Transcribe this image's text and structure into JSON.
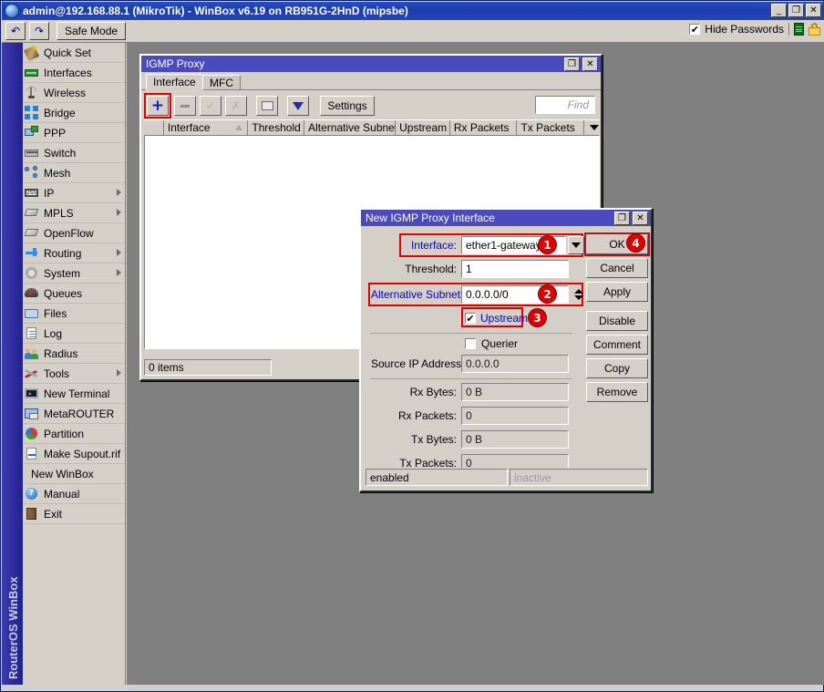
{
  "window": {
    "title": "admin@192.168.88.1 (MikroTik) - WinBox v6.19 on RB951G-2HnD (mipsbe)",
    "icon": "winbox-globe-icon",
    "minimize": "_",
    "restore": "❐",
    "close": "✕"
  },
  "toolbar": {
    "undo_label": "↶",
    "redo_label": "↷",
    "safe_mode_label": "Safe Mode",
    "hide_passwords_label": "Hide Passwords",
    "hide_passwords_checked": "✔",
    "memory_icon": "memory-icon",
    "lock_icon": "lock-icon"
  },
  "rail": {
    "label": "RouterOS WinBox"
  },
  "menu": {
    "items": [
      {
        "label": "Quick Set",
        "icon": "magic-wand-icon",
        "submenu": false
      },
      {
        "label": "Interfaces",
        "icon": "network-card-icon",
        "submenu": false
      },
      {
        "label": "Wireless",
        "icon": "antenna-icon",
        "submenu": false
      },
      {
        "label": "Bridge",
        "icon": "bridge-icon",
        "submenu": false
      },
      {
        "label": "PPP",
        "icon": "ppp-icon",
        "submenu": false
      },
      {
        "label": "Switch",
        "icon": "switch-icon",
        "submenu": false
      },
      {
        "label": "Mesh",
        "icon": "mesh-icon",
        "submenu": false
      },
      {
        "label": "IP",
        "icon": "ip-icon",
        "submenu": true
      },
      {
        "label": "MPLS",
        "icon": "tag-icon",
        "submenu": true
      },
      {
        "label": "OpenFlow",
        "icon": "tag-icon",
        "submenu": false
      },
      {
        "label": "Routing",
        "icon": "routing-icon",
        "submenu": true
      },
      {
        "label": "System",
        "icon": "gear-icon",
        "submenu": true
      },
      {
        "label": "Queues",
        "icon": "queues-icon",
        "submenu": false
      },
      {
        "label": "Files",
        "icon": "folder-icon",
        "submenu": false
      },
      {
        "label": "Log",
        "icon": "log-icon",
        "submenu": false
      },
      {
        "label": "Radius",
        "icon": "users-icon",
        "submenu": false
      },
      {
        "label": "Tools",
        "icon": "tools-icon",
        "submenu": true
      },
      {
        "label": "New Terminal",
        "icon": "terminal-icon",
        "submenu": false
      },
      {
        "label": "MetaROUTER",
        "icon": "metarouter-icon",
        "submenu": false
      },
      {
        "label": "Partition",
        "icon": "partition-pie-icon",
        "submenu": false
      },
      {
        "label": "Make Supout.rif",
        "icon": "supout-file-icon",
        "submenu": false
      },
      {
        "label": "New WinBox",
        "icon": "",
        "submenu": false
      },
      {
        "label": "Manual",
        "icon": "question-icon",
        "submenu": false
      },
      {
        "label": "Exit",
        "icon": "exit-door-icon",
        "submenu": false
      }
    ]
  },
  "igmp_window": {
    "title": "IGMP Proxy",
    "restore": "❐",
    "close": "✕",
    "tabs": [
      {
        "label": "Interface",
        "active": true
      },
      {
        "label": "MFC",
        "active": false
      }
    ],
    "toolbar": {
      "add_label": "+",
      "remove_label": "−",
      "enable_label": "✓",
      "disable_label": "✗",
      "comment_label": "comment-icon",
      "filter_label": "filter-icon",
      "settings_label": "Settings"
    },
    "find_placeholder": "Find",
    "columns": [
      "Interface",
      "Threshold",
      "Alternative Subnets",
      "Upstream",
      "Rx Packets",
      "Tx Packets"
    ],
    "rows": [],
    "status": "0 items"
  },
  "dialog": {
    "title": "New IGMP Proxy Interface",
    "restore": "❐",
    "close": "✕",
    "fields": {
      "interface_label": "Interface:",
      "interface_value": "ether1-gateway",
      "threshold_label": "Threshold:",
      "threshold_value": "1",
      "alt_subnets_label": "Alternative Subnets:",
      "alt_subnets_value": "0.0.0.0/0",
      "upstream_label": "Upstream",
      "upstream_checked": "✔",
      "querier_label": "Querier",
      "querier_checked": "",
      "source_ip_label": "Source IP Address:",
      "source_ip_value": "0.0.0.0",
      "rx_bytes_label": "Rx Bytes:",
      "rx_bytes_value": "0 B",
      "rx_packets_label": "Rx Packets:",
      "rx_packets_value": "0",
      "tx_bytes_label": "Tx Bytes:",
      "tx_bytes_value": "0 B",
      "tx_packets_label": "Tx Packets:",
      "tx_packets_value": "0"
    },
    "buttons": [
      "OK",
      "Cancel",
      "Apply",
      "Disable",
      "Comment",
      "Copy",
      "Remove"
    ],
    "status_left": "enabled",
    "status_right": "inactive"
  },
  "annotations": {
    "accent_color": "#e00000",
    "badges": [
      {
        "n": "1",
        "target": "interface-field"
      },
      {
        "n": "2",
        "target": "alternative-subnets-field"
      },
      {
        "n": "3",
        "target": "upstream-checkbox"
      },
      {
        "n": "4",
        "target": "ok-button"
      }
    ]
  }
}
